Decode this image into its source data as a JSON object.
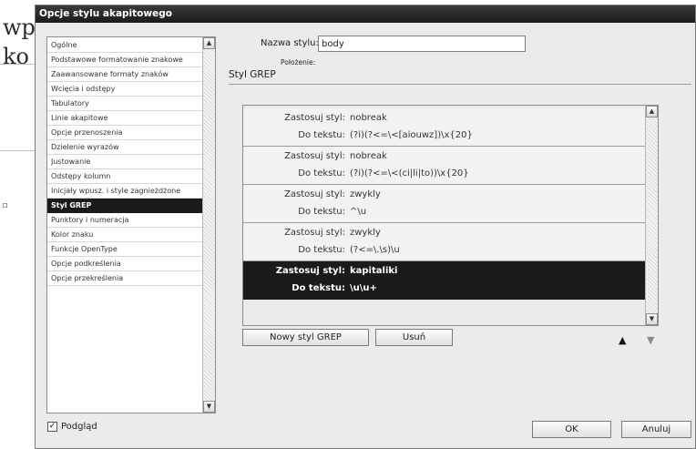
{
  "background": {
    "text_line1": "wp",
    "text_line2": "ko"
  },
  "dialog": {
    "title": "Opcje stylu akapitowego",
    "categories": [
      {
        "label": "Ogólne"
      },
      {
        "label": "Podstawowe formatowanie znakowe"
      },
      {
        "label": "Zaawansowane formaty znaków"
      },
      {
        "label": "Wcięcia i odstępy"
      },
      {
        "label": "Tabulatory"
      },
      {
        "label": "Linie akapitowe"
      },
      {
        "label": "Opcje przenoszenia"
      },
      {
        "label": "Dzielenie wyrazów"
      },
      {
        "label": "Justowanie"
      },
      {
        "label": "Odstępy kolumn"
      },
      {
        "label": "Inicjały wpusz. i style zagnieżdżone"
      },
      {
        "label": "Styl GREP",
        "selected": true
      },
      {
        "label": "Punktory i numeracja"
      },
      {
        "label": "Kolor znaku"
      },
      {
        "label": "Funkcje OpenType"
      },
      {
        "label": "Opcje podkreślenia"
      },
      {
        "label": "Opcje przekreślenia"
      }
    ],
    "style_name_label": "Nazwa stylu:",
    "style_name_value": "body",
    "location_label": "Położenie:",
    "section_title": "Styl GREP",
    "rule_apply_label": "Zastosuj styl:",
    "rule_text_label": "Do tekstu:",
    "grep_rules": [
      {
        "style": "nobreak",
        "pattern": "(?i)(?<=\\<[aiouwz])\\x{20}"
      },
      {
        "style": "nobreak",
        "pattern": "(?i)(?<=\\<(ci|li|to))\\x{20}"
      },
      {
        "style": "zwykly",
        "pattern": "^\\u"
      },
      {
        "style": "zwykly",
        "pattern": "(?<=\\.\\s)\\u"
      },
      {
        "style": "kapitaliki",
        "pattern": "\\u\\u+",
        "selected": true
      }
    ],
    "new_grep_button": "Nowy styl GREP",
    "delete_button": "Usuń",
    "move_up": "▲",
    "move_down": "▼",
    "preview_label": "Podgląd",
    "preview_checked": true,
    "ok_button": "OK",
    "cancel_button": "Anuluj"
  },
  "colors": {
    "selection": "#1a1a1a",
    "dialog_bg": "#ebebeb",
    "titlebar": "#1b1b1b"
  }
}
